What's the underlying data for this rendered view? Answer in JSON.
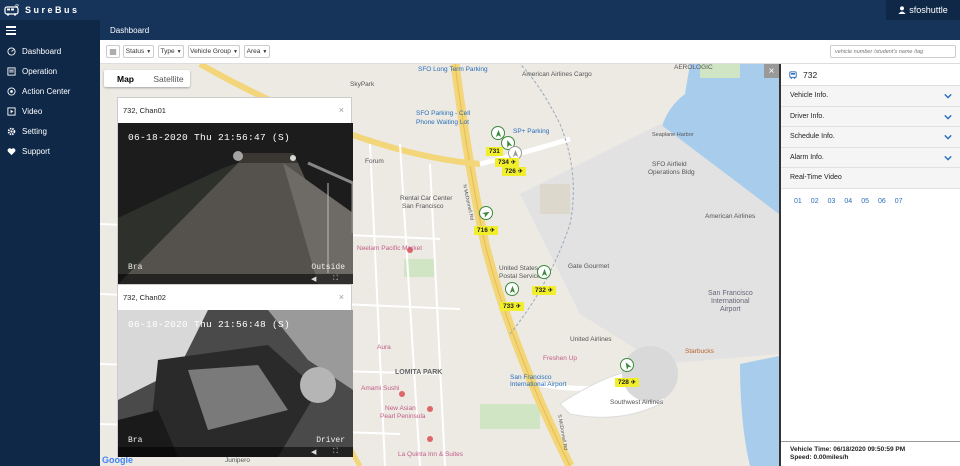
{
  "app": {
    "name": "SureBus"
  },
  "user": {
    "name": "sfoshuttle"
  },
  "nav": [
    {
      "label": "Dashboard",
      "icon": "dashboard-icon"
    },
    {
      "label": "Operation",
      "icon": "operation-icon"
    },
    {
      "label": "Action Center",
      "icon": "action-center-icon"
    },
    {
      "label": "Video",
      "icon": "video-icon"
    },
    {
      "label": "Setting",
      "icon": "gear-icon"
    },
    {
      "label": "Support",
      "icon": "heart-icon"
    }
  ],
  "page": {
    "title": "Dashboard"
  },
  "filters": {
    "status": "Status",
    "type": "Type",
    "vehicle_group": "Vehicle Group",
    "area": "Area",
    "search_placeholder": "vehicle number /student's name /tag"
  },
  "map": {
    "toggle": {
      "map": "Map",
      "satellite": "Satellite"
    },
    "google": "Google",
    "places": [
      {
        "key": "skypark",
        "text": "SkyPark"
      },
      {
        "key": "aatc",
        "text": "American Airlines Cargo"
      },
      {
        "key": "aaero",
        "text": "AEROLOGIC"
      },
      {
        "key": "sfolong",
        "text": "SFO Long Term Parking"
      },
      {
        "key": "sfocell1",
        "text": "SFO Parking - Cell"
      },
      {
        "key": "sfocell2",
        "text": "Phone Waiting Lot"
      },
      {
        "key": "spplus",
        "text": "SP+ Parking"
      },
      {
        "key": "seaplane",
        "text": "Seaplane Harbor"
      },
      {
        "key": "airfield1",
        "text": "SFO Airfield"
      },
      {
        "key": "airfield2",
        "text": "Operations Bldg"
      },
      {
        "key": "rental1",
        "text": "Rental Car Center"
      },
      {
        "key": "rental2",
        "text": "San Francisco"
      },
      {
        "key": "aa",
        "text": "American Airlines"
      },
      {
        "key": "neelam",
        "text": "Neelam Pacific Market"
      },
      {
        "key": "usps1",
        "text": "United States"
      },
      {
        "key": "usps2",
        "text": "Postal Service"
      },
      {
        "key": "gate",
        "text": "Gate Gourmet"
      },
      {
        "key": "sfi1",
        "text": "San Francisco"
      },
      {
        "key": "sfi2",
        "text": "International"
      },
      {
        "key": "sfi3",
        "text": "Airport"
      },
      {
        "key": "ual",
        "text": "United Airlines"
      },
      {
        "key": "aura",
        "text": "Aura"
      },
      {
        "key": "freshen",
        "text": "Freshen Up"
      },
      {
        "key": "starbucks",
        "text": "Starbucks"
      },
      {
        "key": "lomita",
        "text": "LOMITA PARK"
      },
      {
        "key": "sfiap1",
        "text": "San Francisco"
      },
      {
        "key": "sfiap2",
        "text": "International Airport"
      },
      {
        "key": "swa",
        "text": "Southwest Airlines"
      },
      {
        "key": "amami",
        "text": "Amami Sushi"
      },
      {
        "key": "newasian1",
        "text": "New Asian"
      },
      {
        "key": "newasian2",
        "text": "Pearl Peninsula"
      },
      {
        "key": "laquinta",
        "text": "La Quinta Inn & Suites"
      },
      {
        "key": "junipero",
        "text": "Junipero"
      },
      {
        "key": "mcdonnell",
        "text": "N McDonnell Rd"
      },
      {
        "key": "mcdonnell2",
        "text": "S McDonnell Rd"
      },
      {
        "key": "forum",
        "text": "Forum"
      }
    ],
    "vehicles": [
      {
        "id": "731"
      },
      {
        "id": "734"
      },
      {
        "id": "726"
      },
      {
        "id": "716"
      },
      {
        "id": "732"
      },
      {
        "id": "733"
      },
      {
        "id": "728"
      }
    ]
  },
  "videos": [
    {
      "title": "732, Chan01",
      "timestamp": "06-18-2020 Thu 21:56:47 (S)",
      "cap_left": "Bra",
      "cap_right": "Outside"
    },
    {
      "title": "732, Chan02",
      "timestamp": "06-18-2020 Thu 21:56:48 (S)",
      "cap_left": "Bra",
      "cap_right": "Driver"
    }
  ],
  "panel": {
    "vehicle": "732",
    "sections": [
      {
        "label": "Vehicle Info.",
        "expandable": true
      },
      {
        "label": "Driver Info.",
        "expandable": true
      },
      {
        "label": "Schedule Info.",
        "expandable": true
      },
      {
        "label": "Alarm Info.",
        "expandable": true
      },
      {
        "label": "Real-Time Video",
        "expandable": false
      }
    ],
    "channels": [
      "01",
      "02",
      "03",
      "04",
      "05",
      "06",
      "07"
    ],
    "vehicle_time": "Vehicle Time: 06/18/2020 09:50:59 PM",
    "speed": "Speed: 0.00miles/h"
  },
  "colors": {
    "navy": "#16335a",
    "navy_dark": "#0f2848",
    "vehicle_green": "#3a8a3a",
    "tag_yellow": "#f1ef2b",
    "link_blue": "#2a6ebb"
  }
}
